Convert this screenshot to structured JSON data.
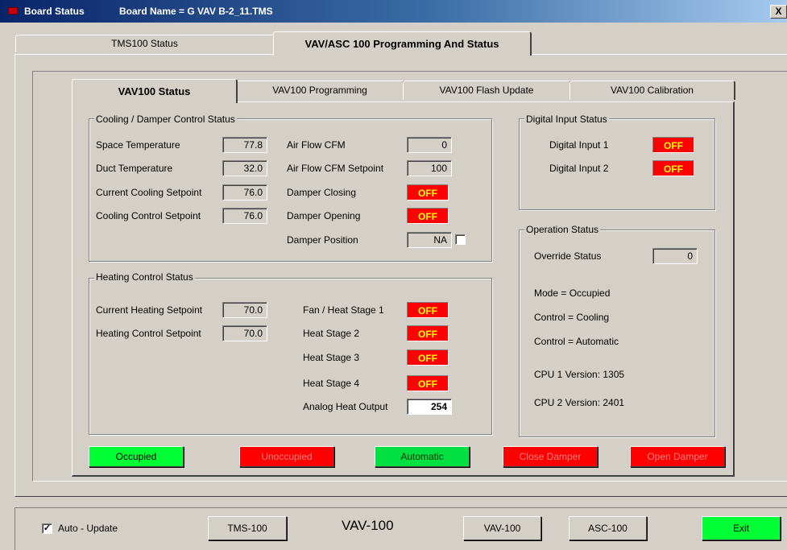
{
  "window": {
    "title": "Board Status",
    "board_name": "Board Name = G VAV B-2_11.TMS",
    "close_glyph": "X"
  },
  "outer_tabs": [
    {
      "label": "TMS100 Status"
    },
    {
      "label": "VAV/ASC 100 Programming And Status",
      "selected": true
    }
  ],
  "inner_tabs": [
    {
      "label": "VAV100 Status",
      "selected": true
    },
    {
      "label": "VAV100 Programming"
    },
    {
      "label": "VAV100 Flash Update"
    },
    {
      "label": "VAV100 Calibration"
    }
  ],
  "cooling": {
    "legend": "Cooling / Damper Control Status",
    "space_temp": {
      "label": "Space Temperature",
      "value": "77.8"
    },
    "duct_temp": {
      "label": "Duct Temperature",
      "value": "32.0"
    },
    "current_cool_sp": {
      "label": "Current Cooling Setpoint",
      "value": "76.0"
    },
    "cool_control_sp": {
      "label": "Cooling Control Setpoint",
      "value": "76.0"
    },
    "air_flow": {
      "label": "Air Flow CFM",
      "value": "0"
    },
    "air_flow_sp": {
      "label": "Air Flow CFM Setpoint",
      "value": "100"
    },
    "damper_closing": {
      "label": "Damper Closing",
      "value": "OFF"
    },
    "damper_opening": {
      "label": "Damper Opening",
      "value": "OFF"
    },
    "damper_position": {
      "label": "Damper Position",
      "value": "NA",
      "checked": false
    }
  },
  "heating": {
    "legend": "Heating Control Status",
    "current_heat_sp": {
      "label": "Current Heating Setpoint",
      "value": "70.0"
    },
    "heat_control_sp": {
      "label": "Heating Control Setpoint",
      "value": "70.0"
    },
    "fan_stage1": {
      "label": "Fan / Heat Stage 1",
      "value": "OFF"
    },
    "stage2": {
      "label": "Heat Stage 2",
      "value": "OFF"
    },
    "stage3": {
      "label": "Heat Stage 3",
      "value": "OFF"
    },
    "stage4": {
      "label": "Heat Stage 4",
      "value": "OFF"
    },
    "analog_out": {
      "label": "Analog Heat Output",
      "value": "254"
    }
  },
  "digital": {
    "legend": "Digital Input Status",
    "di1": {
      "label": "Digital Input 1",
      "value": "OFF"
    },
    "di2": {
      "label": "Digital Input 2",
      "value": "OFF"
    }
  },
  "operation": {
    "legend": "Operation Status",
    "override": {
      "label": "Override Status",
      "value": "0"
    },
    "mode": "Mode = Occupied",
    "control1": "Control = Cooling",
    "control2": "Control = Automatic",
    "cpu1": "CPU 1 Version: 1305",
    "cpu2": "CPU 2 Version: 2401"
  },
  "commands": {
    "occupied": "Occupied",
    "unoccupied": "Unoccupied",
    "automatic": "Automatic",
    "close_damper": "Close Damper",
    "open_damper": "Open Damper"
  },
  "bottom": {
    "auto_update": {
      "label": "Auto - Update",
      "checked": true
    },
    "tms_button": "TMS-100",
    "center_label": "VAV-100",
    "vav_button": "VAV-100",
    "asc_button": "ASC-100",
    "exit_button": "Exit"
  },
  "colors": {
    "indicator_off": "#ff0000",
    "indicator_text": "#ffff00",
    "green_button": "#00ff33",
    "red_button": "#ff0000",
    "title_bar": "#0a246a"
  }
}
